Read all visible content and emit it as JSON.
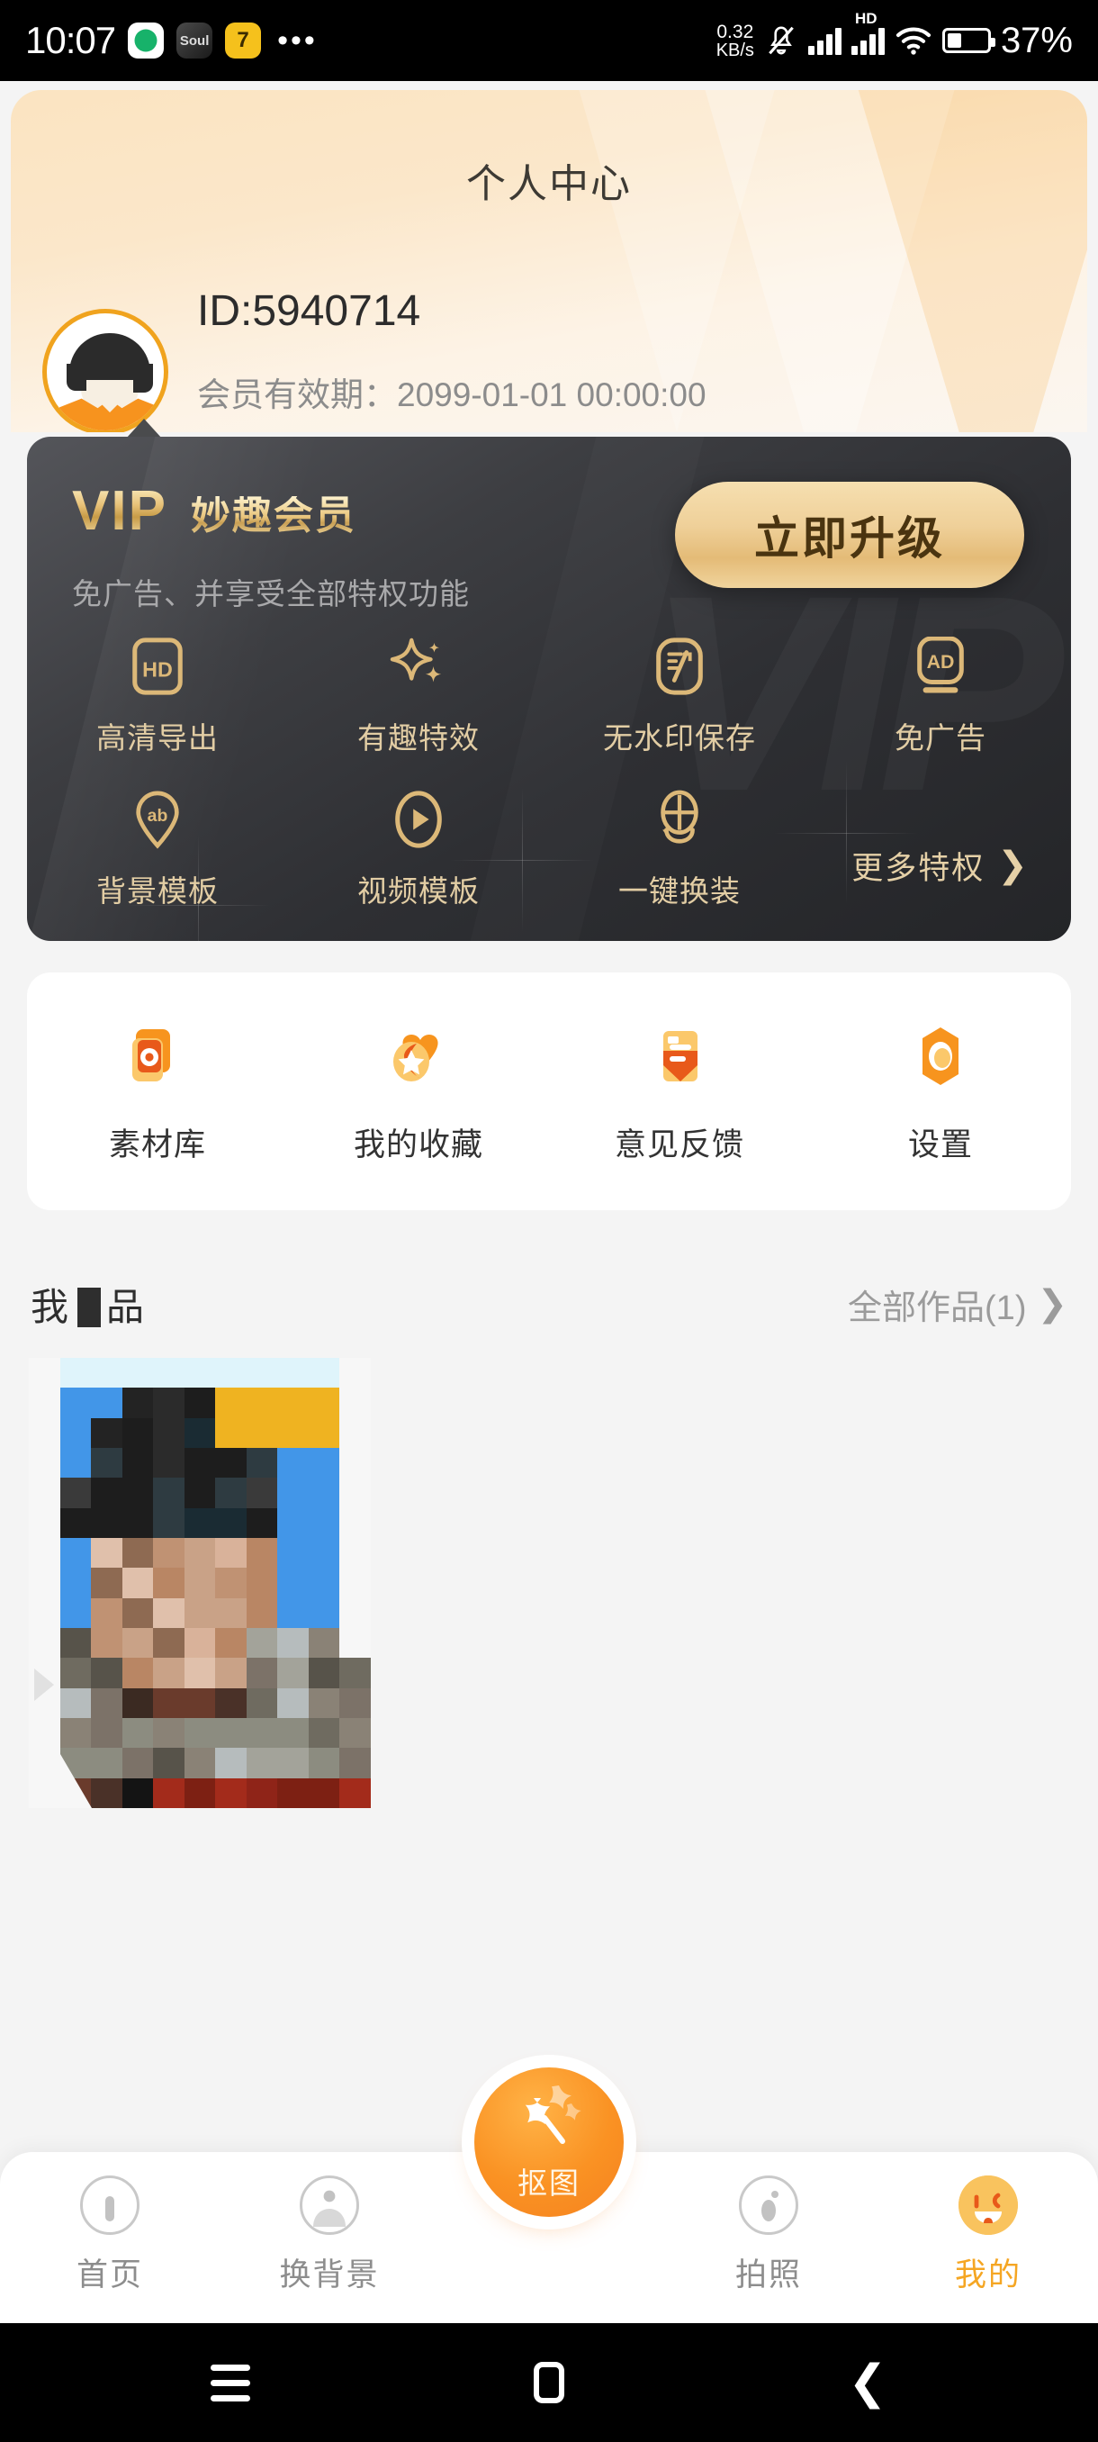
{
  "status_bar": {
    "time": "10:07",
    "app_icons": [
      "wechat-like-green-icon",
      "Soul",
      "7"
    ],
    "overflow": "•••",
    "net_speed_value": "0.32",
    "net_speed_unit": "KB/s",
    "mute_icon": "mute-vibrate-icon",
    "signal_label": "HD",
    "wifi_icon": "wifi-icon",
    "battery_percent": "37%"
  },
  "header": {
    "title": "个人中心",
    "user_id": "ID:5940714",
    "membership_expiry": "会员有效期：2099-01-01 00:00:00",
    "avatar_alt": "user-avatar",
    "bg_color": "#fbe4c1"
  },
  "vip_card": {
    "logo": "VIP",
    "name": "妙趣会员",
    "subtitle": "免广告、并享受全部特权功能",
    "upgrade_button": "立即升级",
    "watermark": "VIP",
    "gold_color": "#e4bb77",
    "perks_row1": [
      {
        "icon": "hd-icon",
        "label": "高清导出"
      },
      {
        "icon": "sparkle-icon",
        "label": "有趣特效"
      },
      {
        "icon": "no-watermark-icon",
        "label": "无水印保存"
      },
      {
        "icon": "no-ads-icon",
        "label": "免广告"
      }
    ],
    "perks_row2": [
      {
        "icon": "background-template-icon",
        "label": "背景模板"
      },
      {
        "icon": "video-template-icon",
        "label": "视频模板"
      },
      {
        "icon": "one-tap-outfit-icon",
        "label": "一键换装"
      }
    ],
    "more_privileges": "更多特权",
    "more_chevron": "❯"
  },
  "menu": {
    "items": [
      {
        "icon": "material-library-icon",
        "label": "素材库"
      },
      {
        "icon": "my-favorites-icon",
        "label": "我的收藏"
      },
      {
        "icon": "feedback-icon",
        "label": "意见反馈"
      },
      {
        "icon": "settings-icon",
        "label": "设置"
      }
    ]
  },
  "works": {
    "title_prefix": "我",
    "title_suffix": "品",
    "all_works": "全部作品(1)",
    "chevron": "❯",
    "thumbnail_alt": "pixelated-portrait-thumbnail"
  },
  "bottom_nav": {
    "items": [
      {
        "icon": "home-icon",
        "label": "首页",
        "active": false
      },
      {
        "icon": "change-background-icon",
        "label": "换背景",
        "active": false
      },
      {
        "icon": "photo-icon",
        "label": "拍照",
        "active": false
      },
      {
        "icon": "profile-smiley-icon",
        "label": "我的",
        "active": true
      }
    ],
    "fab_label": "抠图",
    "fab_icon": "magic-wand-star-icon",
    "active_color": "#f5a623"
  },
  "android_nav": {
    "recents": "recents-icon",
    "home": "home-square-icon",
    "back": "back-chevron-icon"
  }
}
